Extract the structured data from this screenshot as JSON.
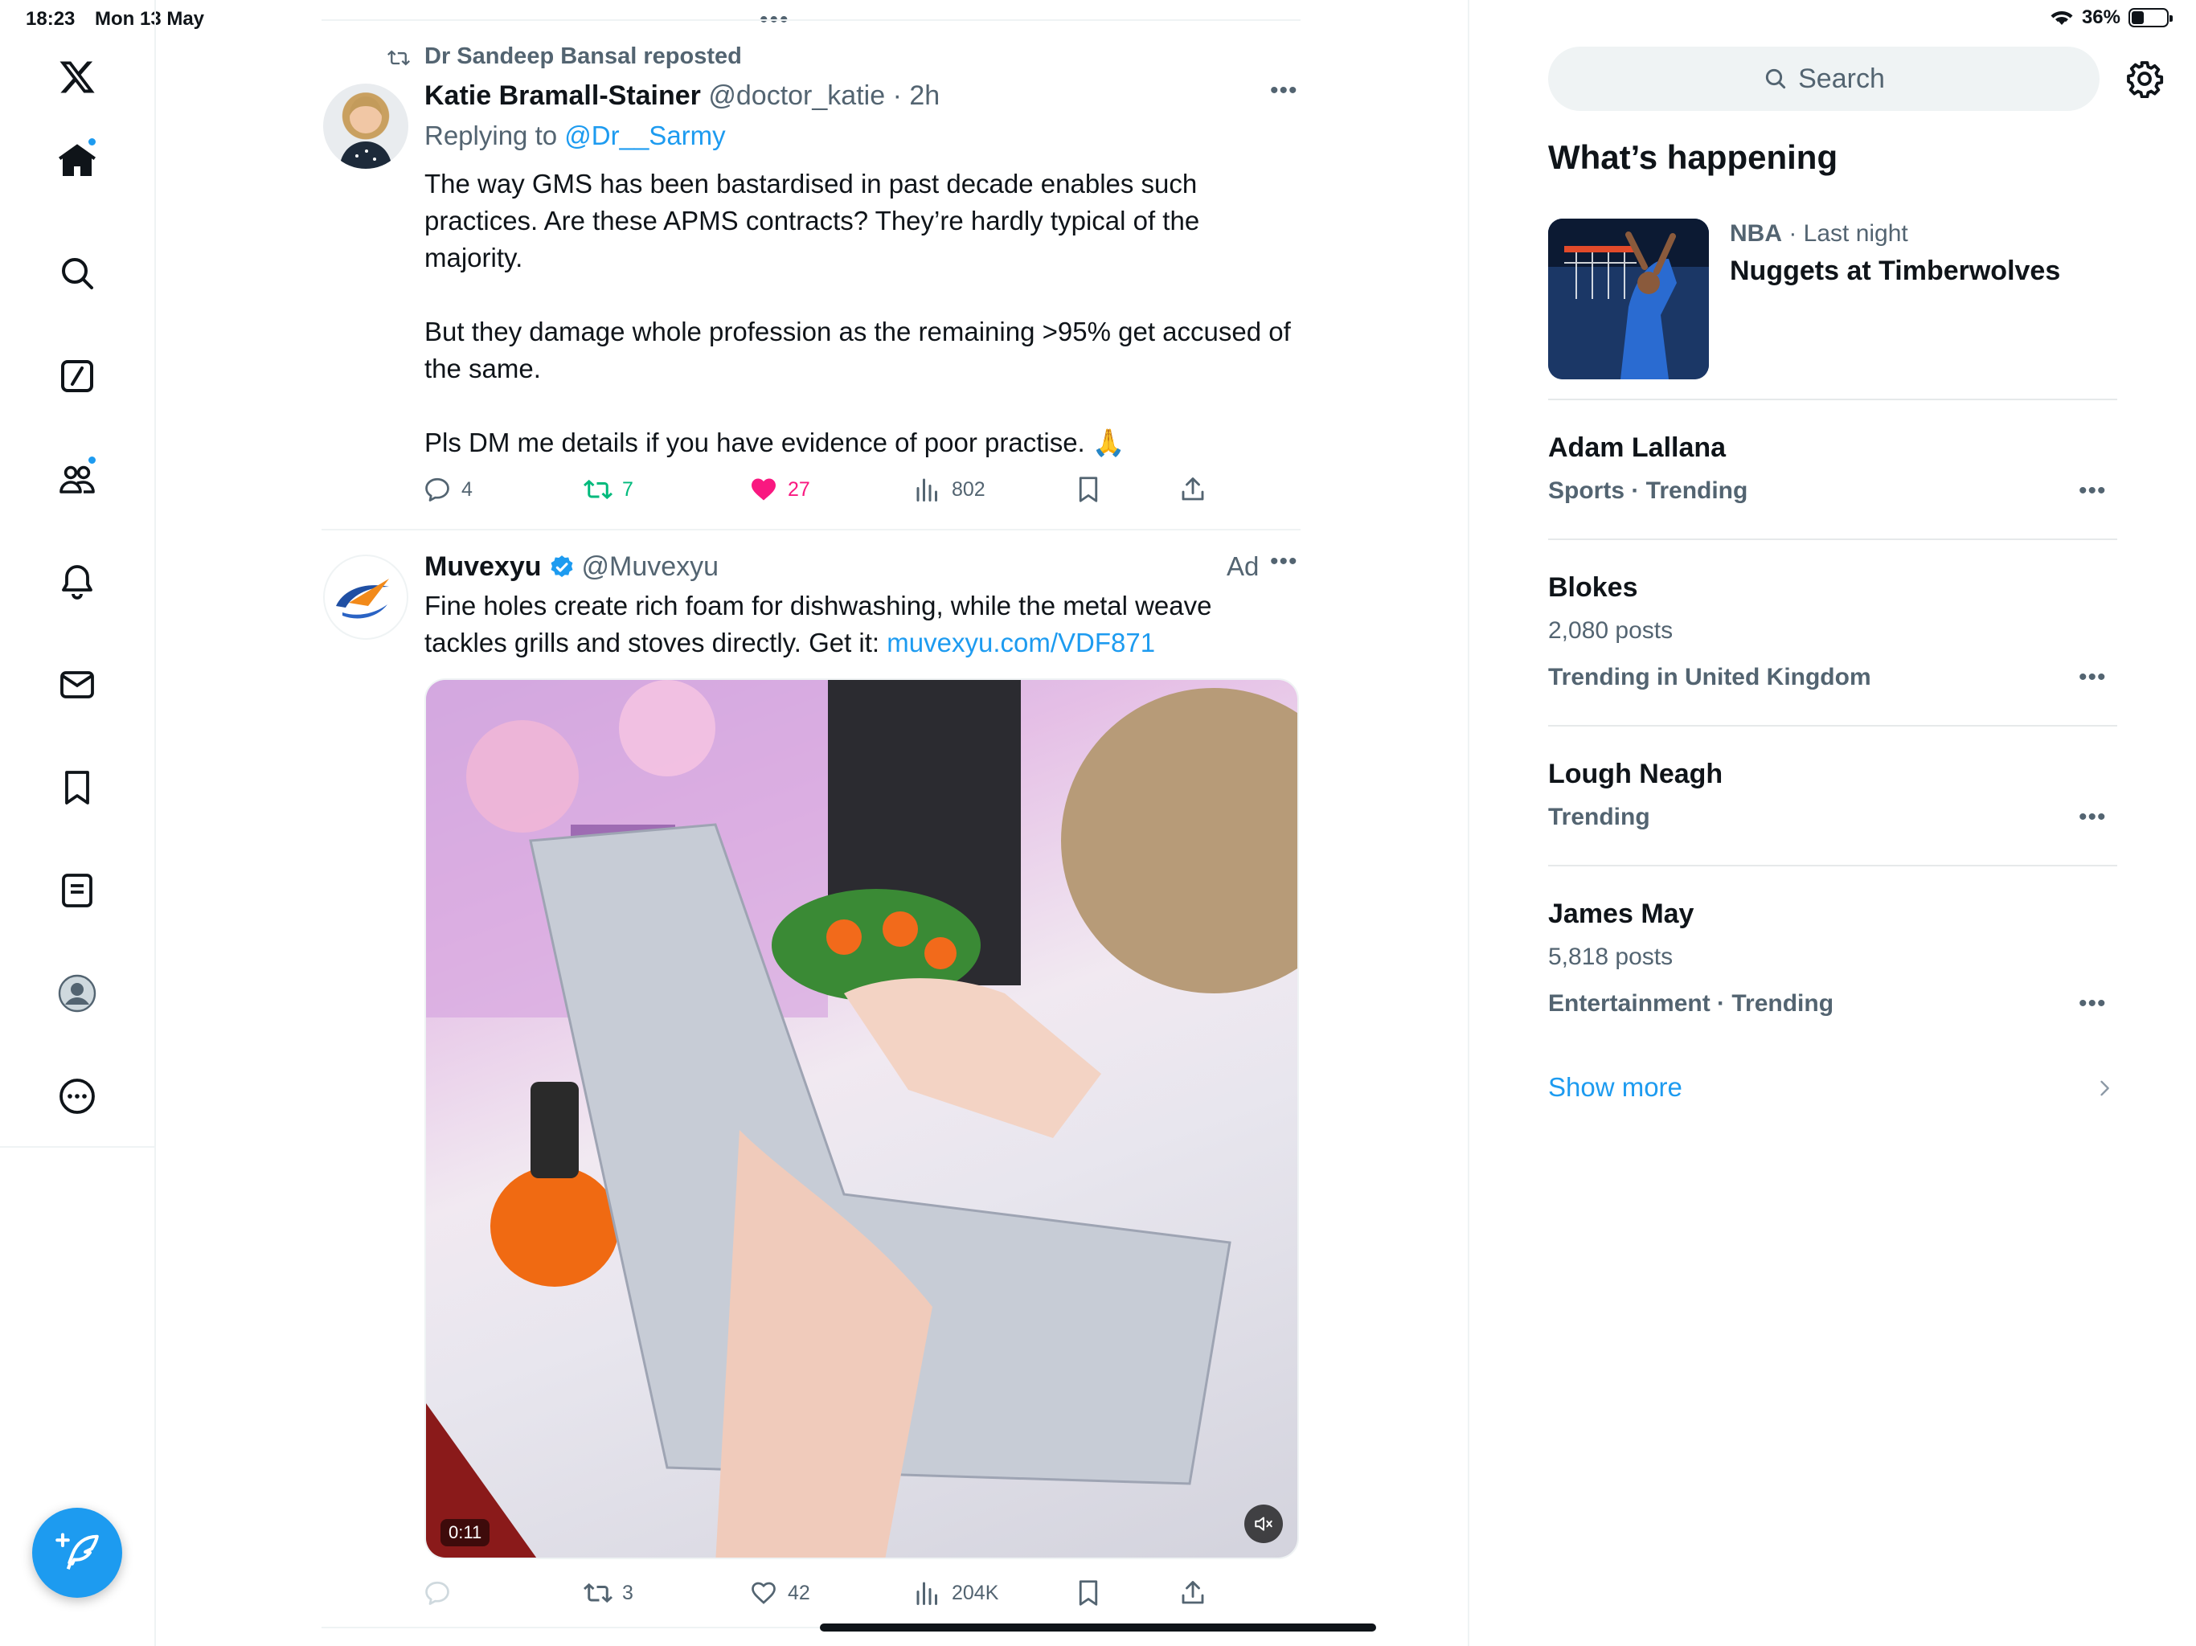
{
  "status_bar": {
    "time": "18:23",
    "date": "Mon 13 May",
    "battery": "36%",
    "battery_level": 0.36
  },
  "nav": {
    "items": [
      "x-logo",
      "home",
      "search",
      "grok",
      "communities",
      "notifications",
      "messages",
      "bookmarks",
      "lists",
      "profile",
      "more"
    ],
    "compose_label": "Post"
  },
  "tweet1": {
    "repost_label": "Dr Sandeep Bansal reposted",
    "author_name": "Katie Bramall-Stainer",
    "handle": "@doctor_katie",
    "time": "· 2h",
    "replying_prefix": "Replying to",
    "replying_to": "@Dr__Sarmy",
    "paragraphs": [
      "The way GMS has been bastardised in past decade enables such practices. Are these APMS contracts? They’re hardly typical of the majority.",
      "But they damage whole profession as the remaining >95% get accused of the same.",
      "Pls DM me details if you have evidence of poor practise. 🙏"
    ],
    "replies": "4",
    "reposts": "7",
    "likes": "27",
    "views": "802"
  },
  "tweet2": {
    "author_name": "Muvexyu",
    "handle": "@Muvexyu",
    "ad_label": "Ad",
    "text": "Fine holes create rich foam for dishwashing, while the metal weave tackles grills and stoves directly. Get it: ",
    "link": "muvexyu.com/VDF871",
    "video_timer": "0:11",
    "replies": "",
    "reposts": "3",
    "likes": "42",
    "views": "204K"
  },
  "right": {
    "search_placeholder": "Search",
    "title": "What’s happening",
    "featured": {
      "category": "NBA",
      "time": "· Last night",
      "headline": "Nuggets at Timberwolves"
    },
    "trends": [
      {
        "title": "Adam Lallana",
        "meta": "Sports · Trending",
        "posts": ""
      },
      {
        "title": "Blokes",
        "posts": "2,080 posts",
        "meta": "Trending in United Kingdom"
      },
      {
        "title": "Lough Neagh",
        "meta": "Trending",
        "posts": ""
      },
      {
        "title": "James May",
        "posts": "5,818 posts",
        "meta": "Entertainment · Trending"
      }
    ],
    "show_more": "Show more"
  },
  "colors": {
    "accent": "#1d9bf0",
    "like": "#f91880",
    "repost": "#00ba7c",
    "text": "#0f1419",
    "muted": "#536471"
  }
}
